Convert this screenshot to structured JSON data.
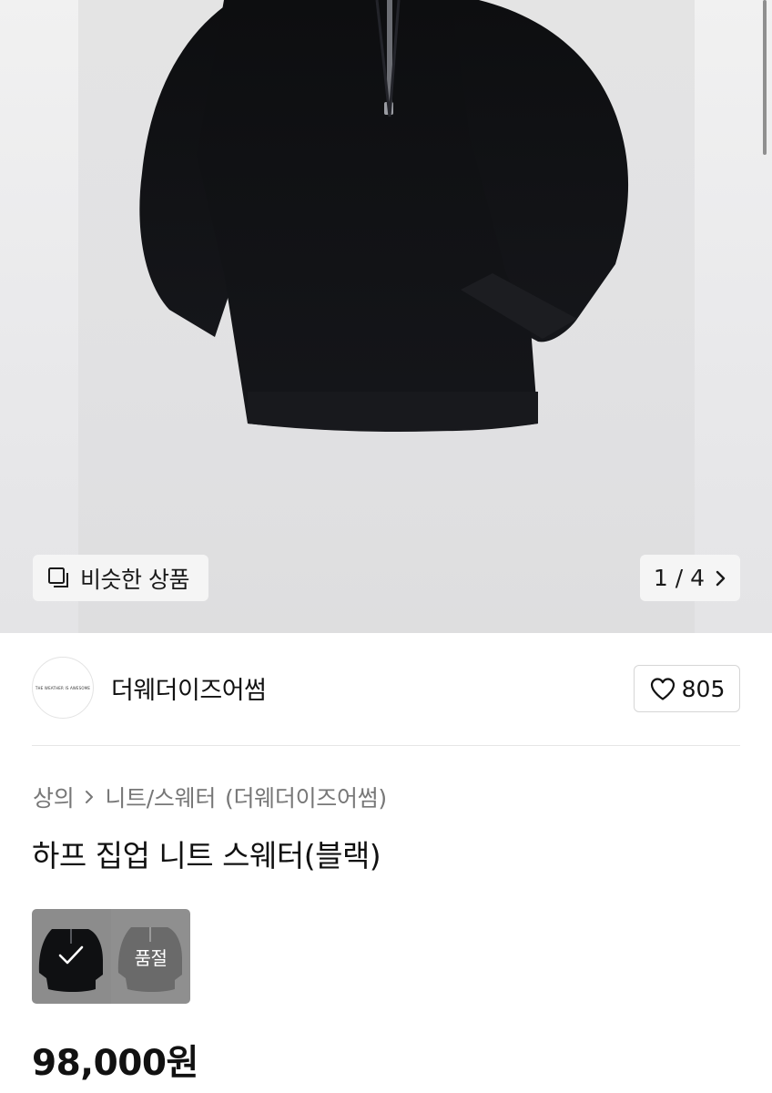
{
  "gallery": {
    "similar_label": "비슷한 상품",
    "pager_text": "1 / 4"
  },
  "brand": {
    "name": "더웨더이즈어썸",
    "logo_text": "THE WEATHER IS AWESOME",
    "likes": "805"
  },
  "breadcrumb": {
    "category": "상의",
    "subcategory": "니트/스웨터",
    "brand": "(더웨더이즈어썸)"
  },
  "product": {
    "title": "하프 집업 니트 스웨터(블랙)",
    "price": "98,000원"
  },
  "options": [
    {
      "color": "black",
      "selected": true
    },
    {
      "color": "grey",
      "status": "품절"
    }
  ]
}
